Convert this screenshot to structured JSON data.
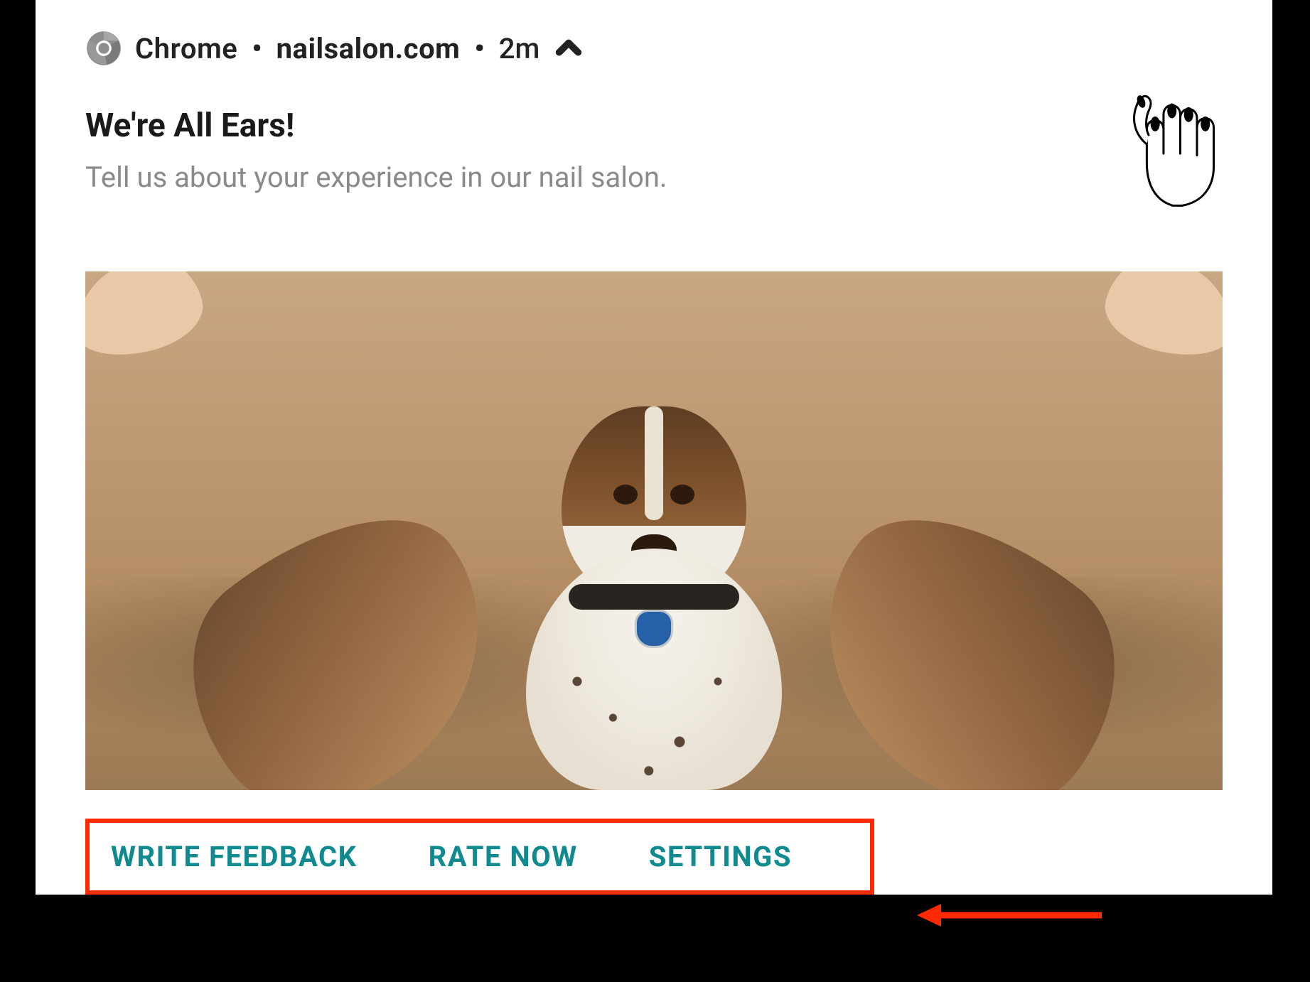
{
  "header": {
    "app": "Chrome",
    "site": "nailsalon.com",
    "time": "2m"
  },
  "notification": {
    "title": "We're All Ears!",
    "subtitle": "Tell us about your experience in our nail salon."
  },
  "actions": {
    "write_feedback": "WRITE FEEDBACK",
    "rate_now": "RATE NOW",
    "settings": "SETTINGS"
  },
  "colors": {
    "accent_teal": "#0f8a8f",
    "highlight_box": "#ff2a00"
  }
}
